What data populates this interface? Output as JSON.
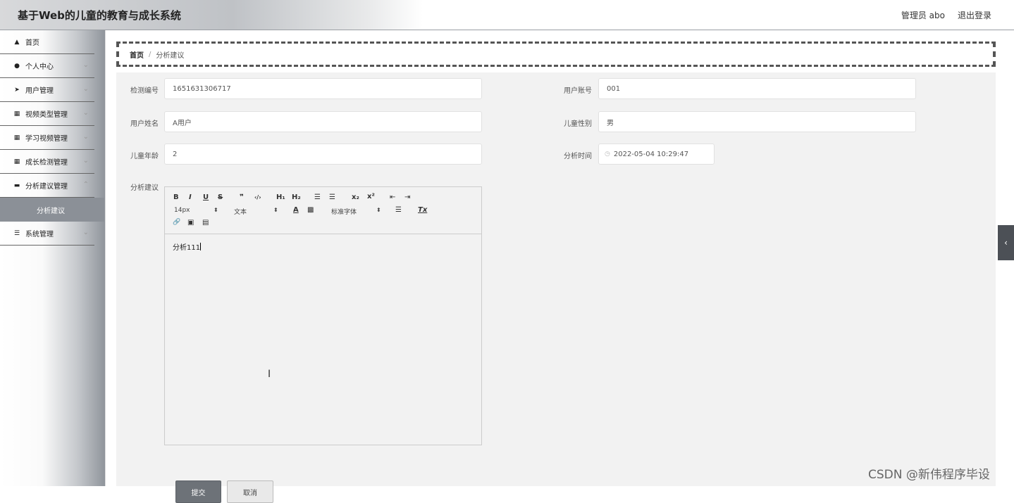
{
  "header": {
    "title": "基于Web的儿童的教育与成长系统",
    "user_label": "管理员 abo",
    "logout_label": "退出登录"
  },
  "sidebar": {
    "items": [
      {
        "label": "首页",
        "icon": "home-icon"
      },
      {
        "label": "个人中心",
        "icon": "user-icon"
      },
      {
        "label": "用户管理",
        "icon": "send-icon"
      },
      {
        "label": "视频类型管理",
        "icon": "grid-icon"
      },
      {
        "label": "学习视频管理",
        "icon": "grid-icon"
      },
      {
        "label": "成长检测管理",
        "icon": "grid-icon"
      },
      {
        "label": "分析建议管理",
        "icon": "comment-icon"
      },
      {
        "label": "系统管理",
        "icon": "list-icon"
      }
    ],
    "active_sub": "分析建议"
  },
  "breadcrumb": {
    "home": "首页",
    "sep": "/",
    "current": "分析建议"
  },
  "form": {
    "jiance_label": "检测编号",
    "jiance_value": "1651631306717",
    "account_label": "用户账号",
    "account_value": "001",
    "name_label": "用户姓名",
    "name_value": "A用户",
    "gender_label": "儿童性别",
    "gender_value": "男",
    "age_label": "儿童年龄",
    "age_value": "2",
    "time_label": "分析时间",
    "time_value": "2022-05-04 10:29:47",
    "advice_label": "分析建议"
  },
  "editor": {
    "toolbar": {
      "bold": "B",
      "italic": "I",
      "underline": "U",
      "strike": "S",
      "quote": "❞",
      "code": "‹/›",
      "h1": "H₁",
      "h2": "H₂",
      "ol": "☰",
      "ul": "☰",
      "sub": "x₂",
      "sup": "x²",
      "outdent": "⇤",
      "indent": "⇥",
      "size": "14px",
      "header": "文本",
      "font": "标准字体",
      "color": "A",
      "bg": "▩",
      "align": "☰",
      "clean": "Tx",
      "link": "🔗",
      "image": "▣",
      "video": "▤"
    },
    "content": "分析111"
  },
  "buttons": {
    "submit": "提交",
    "cancel": "取消"
  },
  "watermark": "CSDN @新伟程序毕设",
  "toggle": "‹"
}
